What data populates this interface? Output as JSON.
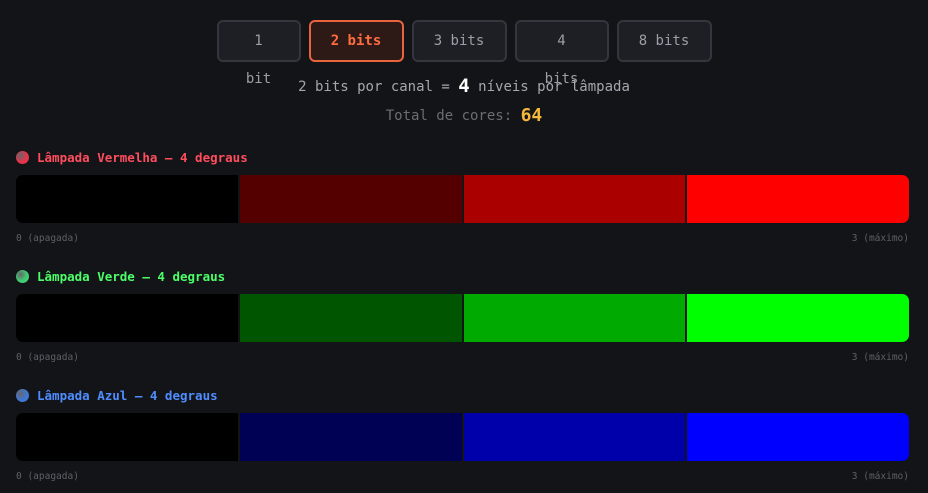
{
  "bit_options": [
    {
      "label": "1 bit",
      "active": false
    },
    {
      "label": "2 bits",
      "active": true
    },
    {
      "label": "3 bits",
      "active": false
    },
    {
      "label": "4 bits",
      "active": false
    },
    {
      "label": "8 bits",
      "active": false
    }
  ],
  "info": {
    "prefix": "2 bits por canal =",
    "levels": "4",
    "suffix": "níveis por lâmpada"
  },
  "total": {
    "label": "Total de cores:",
    "value": "64"
  },
  "lamps": [
    {
      "title": "Lâmpada Vermelha — 4 degraus",
      "title_color": "#ff4d5e",
      "dot_color": "#e8344a",
      "segments": [
        "#000000",
        "#550000",
        "#aa0000",
        "#ff0000"
      ],
      "min_label": "0 (apagada)",
      "max_label": "3 (máximo)"
    },
    {
      "title": "Lâmpada Verde — 4 degraus",
      "title_color": "#4cff68",
      "dot_color": "#3fcf74",
      "segments": [
        "#000000",
        "#005500",
        "#00aa00",
        "#00ff00"
      ],
      "min_label": "0 (apagada)",
      "max_label": "3 (máximo)"
    },
    {
      "title": "Lâmpada Azul — 4 degraus",
      "title_color": "#4f8dff",
      "dot_color": "#3f78d6",
      "segments": [
        "#000000",
        "#000055",
        "#0000aa",
        "#0000ff"
      ],
      "min_label": "0 (apagada)",
      "max_label": "3 (máximo)"
    }
  ]
}
